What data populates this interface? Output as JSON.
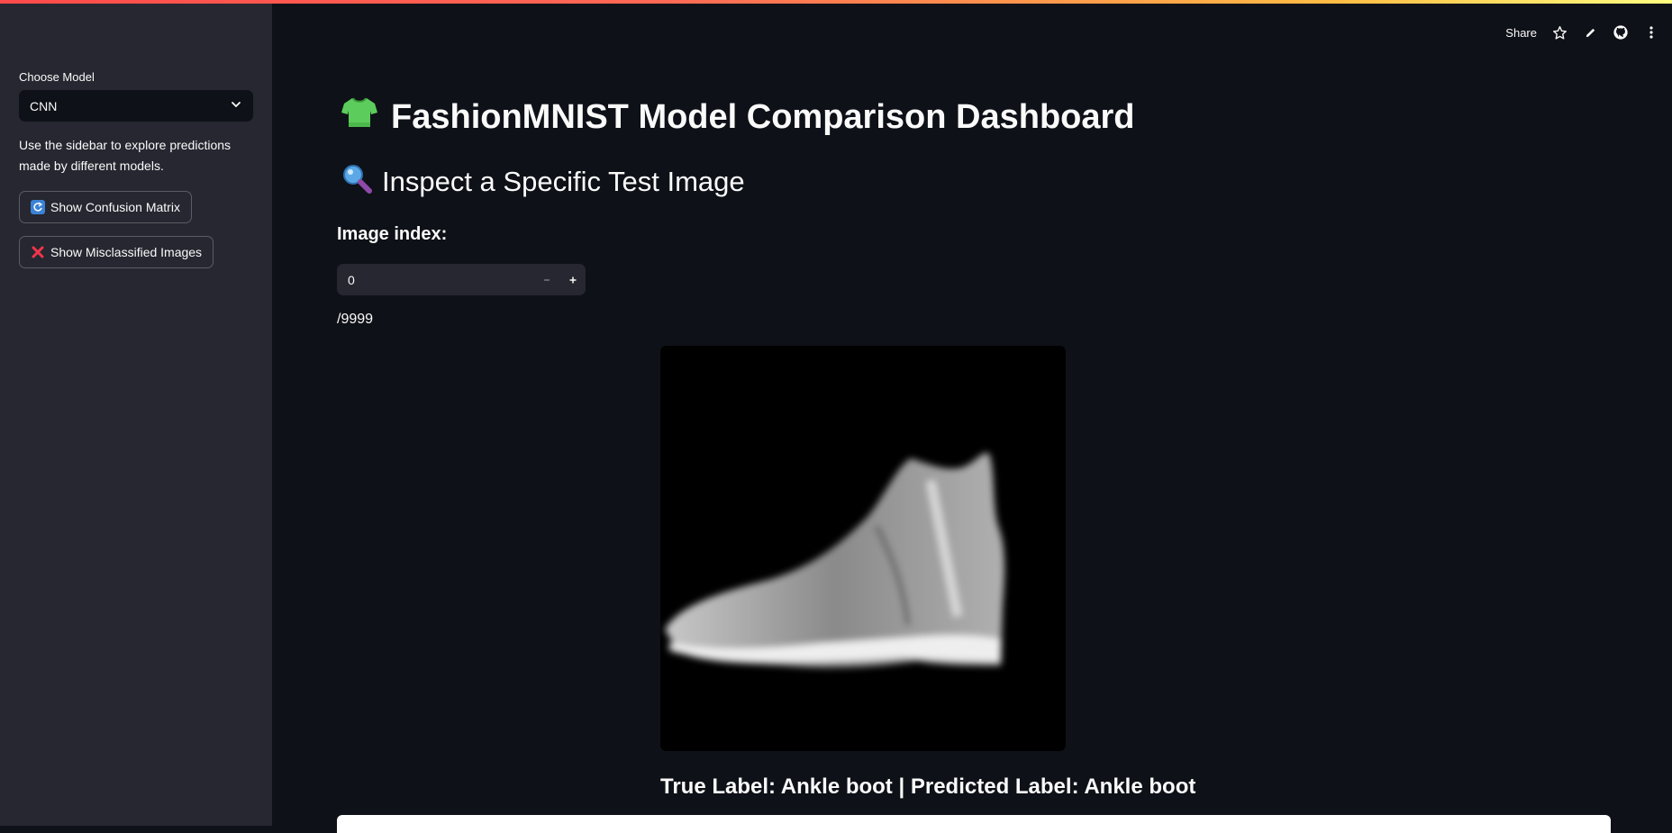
{
  "sidebar": {
    "model_label": "Choose Model",
    "model_selected": "CNN",
    "description": "Use the sidebar to explore predictions made by different models.",
    "buttons": [
      {
        "label": "Show Confusion Matrix",
        "icon": "arrows-counterclockwise-icon"
      },
      {
        "label": "Show Misclassified Images",
        "icon": "cross-mark-icon"
      }
    ]
  },
  "toolbar": {
    "share_label": "Share",
    "icons": [
      "star-icon",
      "pencil-icon",
      "github-icon",
      "more-vertical-icon"
    ]
  },
  "main": {
    "title": "FashionMNIST Model Comparison Dashboard",
    "title_icon": "t-shirt-icon",
    "subtitle": "Inspect a Specific Test Image",
    "subtitle_icon": "magnifying-glass-icon",
    "index_label": "Image index:",
    "index_value": "0",
    "index_max": "/9999",
    "image_description_icon": "ankle-boot-image",
    "caption": "True Label: Ankle boot | Predicted Label: Ankle boot"
  },
  "colors": {
    "background": "#0e1117",
    "sidebar": "#262730",
    "accent": "#ff4b4b"
  }
}
